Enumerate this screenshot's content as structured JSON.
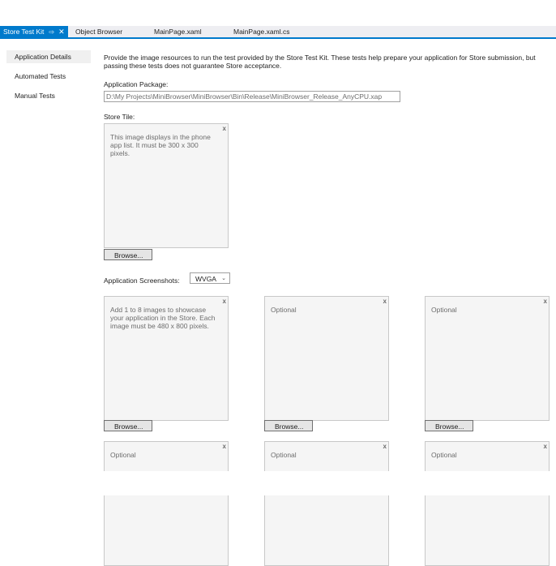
{
  "tabs": {
    "active": {
      "label": "Store Test Kit",
      "pin": "⇨",
      "close": "✕"
    },
    "items": [
      "Object Browser",
      "MainPage.xaml",
      "MainPage.xaml.cs"
    ]
  },
  "sidebar": {
    "items": [
      {
        "label": "Application Details"
      },
      {
        "label": "Automated Tests"
      },
      {
        "label": "Manual Tests"
      }
    ]
  },
  "main": {
    "description": "Provide the image resources to run the test provided by the Store Test Kit. These tests help prepare your application for Store submission, but passing these tests does not guarantee Store acceptance.",
    "package_label": "Application Package:",
    "package_value": "D:\\My Projects\\MiniBrowser\\MiniBrowser\\Bin\\Release\\MiniBrowser_Release_AnyCPU.xap",
    "store_tile_label": "Store Tile:",
    "store_tile_text": "This image displays in the phone app list. It must be 300 x 300 pixels.",
    "close_glyph": "x",
    "browse_label": "Browse...",
    "screenshots_label": "Application Screenshots:",
    "resolution_selected": "WVGA",
    "resolution_chevron": "⌄",
    "screenshot_1_text": "Add 1 to 8 images to showcase your application in the Store. Each image must be 480 x 800 pixels.",
    "optional_label": "Optional"
  }
}
